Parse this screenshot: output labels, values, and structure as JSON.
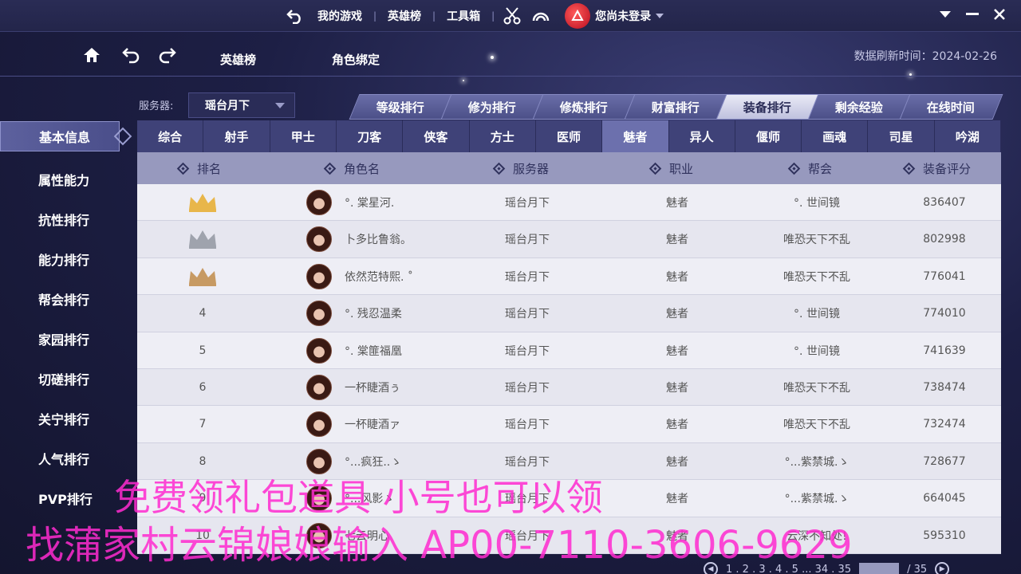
{
  "topnav": {
    "items": [
      "我的游戏",
      "英雄榜",
      "工具箱"
    ],
    "login_text": "您尚未登录"
  },
  "subnav": {
    "tabs": [
      "英雄榜",
      "角色绑定"
    ],
    "refresh_label": "数据刷新时间：",
    "refresh_date": "2024-02-26"
  },
  "server": {
    "label": "服务器:",
    "value": "瑶台月下"
  },
  "rank_tabs": [
    "等级排行",
    "修为排行",
    "修炼排行",
    "财富排行",
    "装备排行",
    "剩余经验",
    "在线时间"
  ],
  "active_rank_tab": 4,
  "sidebar": [
    "基本信息",
    "属性能力",
    "抗性排行",
    "能力排行",
    "帮会排行",
    "家园排行",
    "切磋排行",
    "关宁排行",
    "人气排行",
    "PVP排行"
  ],
  "class_tabs": [
    "综合",
    "射手",
    "甲士",
    "刀客",
    "侠客",
    "方士",
    "医师",
    "魅者",
    "异人",
    "偃师",
    "画魂",
    "司星",
    "吟湖"
  ],
  "active_class_tab": 7,
  "table": {
    "headers": [
      "排名",
      "角色名",
      "服务器",
      "职业",
      "帮会",
      "装备评分"
    ],
    "rows": [
      {
        "rank": "",
        "medal": "gold",
        "name": "°. 棠星河.",
        "server": "瑶台月下",
        "class": "魅者",
        "guild": "°. 世间镜",
        "score": "836407"
      },
      {
        "rank": "",
        "medal": "silver",
        "name": "卜多比鲁翁。",
        "server": "瑶台月下",
        "class": "魅者",
        "guild": "唯恐天下不乱",
        "score": "802998"
      },
      {
        "rank": "",
        "medal": "bronze",
        "name": "依然范特熙. ˚",
        "server": "瑶台月下",
        "class": "魅者",
        "guild": "唯恐天下不乱",
        "score": "776041"
      },
      {
        "rank": "4",
        "medal": "",
        "name": "°. 残忍温柔",
        "server": "瑶台月下",
        "class": "魅者",
        "guild": "°. 世间镜",
        "score": "774010"
      },
      {
        "rank": "5",
        "medal": "",
        "name": "°. 棠篚福凰",
        "server": "瑶台月下",
        "class": "魅者",
        "guild": "°. 世间镜",
        "score": "741639"
      },
      {
        "rank": "6",
        "medal": "",
        "name": "一杯睫酒ぅ",
        "server": "瑶台月下",
        "class": "魅者",
        "guild": "唯恐天下不乱",
        "score": "738474"
      },
      {
        "rank": "7",
        "medal": "",
        "name": "一杯睫酒ァ",
        "server": "瑶台月下",
        "class": "魅者",
        "guild": "唯恐天下不乱",
        "score": "732474"
      },
      {
        "rank": "8",
        "medal": "",
        "name": "°...疯狂..ゝ",
        "server": "瑶台月下",
        "class": "魅者",
        "guild": "°...紫禁城.ゝ",
        "score": "728677"
      },
      {
        "rank": "9",
        "medal": "",
        "name": "°...风影ゝ",
        "server": "瑶台月下",
        "class": "魅者",
        "guild": "°...紫禁城.ゝ",
        "score": "664045"
      },
      {
        "rank": "10",
        "medal": "",
        "name": "七云明心",
        "server": "瑶台月下",
        "class": "魅者",
        "guild": "云深不知处!",
        "score": "595310"
      }
    ]
  },
  "pager": {
    "pages": "1 . 2 . 3 . 4 . 5 ... 34 . 35",
    "total": "/ 35"
  },
  "watermark": {
    "line1": "免费领礼包道具 小号也可以领",
    "line2": "找蒲家村云锦娘娘输入 AP00-7110-3606-9629"
  },
  "colors": {
    "accent": "#6c70ad",
    "header_bg": "#9799be",
    "watermark": "#ff2bd0",
    "gold": "#e8b64a",
    "silver": "#9fa3ad",
    "bronze": "#c79a63"
  }
}
